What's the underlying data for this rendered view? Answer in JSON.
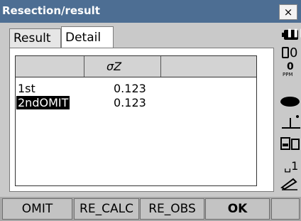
{
  "window": {
    "title": "Resection/result",
    "close_label": "×"
  },
  "tabs": [
    {
      "label": "Result"
    },
    {
      "label": "Detail"
    }
  ],
  "table": {
    "header": {
      "col1": "",
      "col2": "σZ"
    },
    "rows": [
      {
        "label": "1st",
        "value": "0.123",
        "selected": false
      },
      {
        "label": "2ndOMIT",
        "value": "0.123",
        "selected": true
      }
    ]
  },
  "status": {
    "prism_constant": "0",
    "ppm_value": "0",
    "ppm_label": "PPM",
    "space_value": "1",
    "icons": [
      "battery-icon",
      "prism-icon",
      "ppm-icon",
      "laser-icon",
      "tilt-icon",
      "drive-icon",
      "space-icon",
      "input-mode-icon"
    ]
  },
  "softkeys": [
    {
      "label": "OMIT"
    },
    {
      "label": "RE_CALC"
    },
    {
      "label": "RE_OBS"
    },
    {
      "label": "OK"
    },
    {
      "label": ""
    }
  ]
}
